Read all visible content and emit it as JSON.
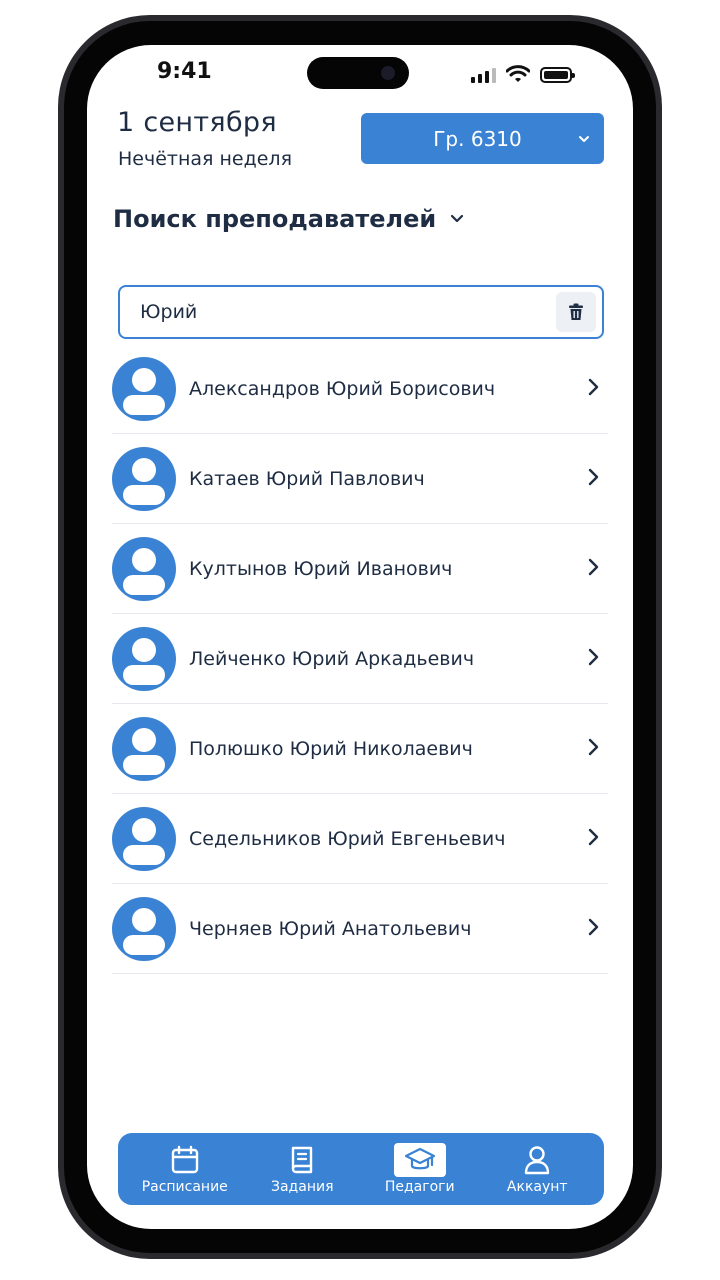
{
  "status_bar": {
    "time": "9:41"
  },
  "header": {
    "date": "1 сентября",
    "week": "Нечётная неделя",
    "group_button": "Гр. 6310"
  },
  "section": {
    "title": "Поиск преподавателей"
  },
  "search": {
    "value": "Юрий"
  },
  "teachers": [
    {
      "name": "Александров Юрий Борисович"
    },
    {
      "name": "Катаев Юрий Павлович"
    },
    {
      "name": "Култынов Юрий Иванович"
    },
    {
      "name": "Лейченко Юрий Аркадьевич"
    },
    {
      "name": "Полюшко Юрий Николаевич"
    },
    {
      "name": "Седельников Юрий Евгеньевич"
    },
    {
      "name": "Черняев Юрий Анатольевич"
    }
  ],
  "nav": {
    "items": [
      {
        "label": "Расписание",
        "icon": "calendar-icon"
      },
      {
        "label": "Задания",
        "icon": "book-icon"
      },
      {
        "label": "Педагоги",
        "icon": "graduation-cap-icon",
        "active": true
      },
      {
        "label": "Аккаунт",
        "icon": "user-icon"
      }
    ]
  },
  "colors": {
    "accent": "#3a83d4",
    "text": "#1f2d44",
    "divider": "#e6e9ee"
  }
}
